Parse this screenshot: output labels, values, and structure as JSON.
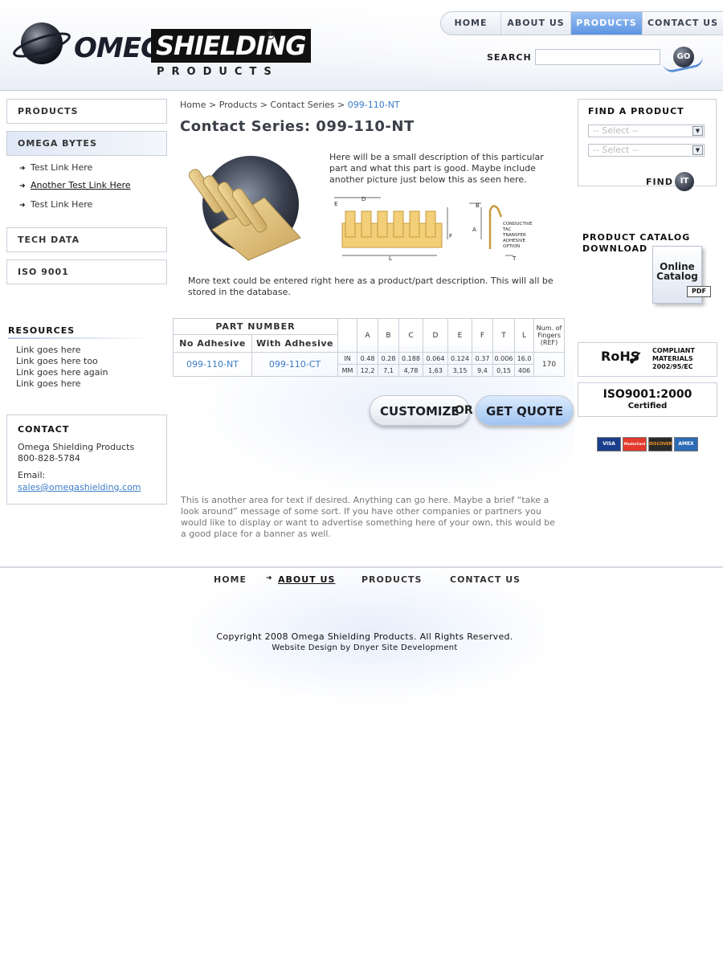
{
  "logo": {
    "word1": "OMEGA",
    "word2": "SHIELDING",
    "registered": "R",
    "sub": "PRODUCTS"
  },
  "topnav": [
    {
      "label": "HOME",
      "active": false
    },
    {
      "label": "ABOUT US",
      "active": false
    },
    {
      "label": "PRODUCTS",
      "active": true
    },
    {
      "label": "CONTACT US",
      "active": false
    }
  ],
  "search": {
    "label": "SEARCH",
    "value": "",
    "go_label": "GO"
  },
  "sidebar": {
    "products": "PRODUCTS",
    "omega_bytes": "OMEGA BYTES",
    "sublinks": [
      "Test Link Here",
      "Another Test Link Here",
      "Test Link Here"
    ],
    "tech_data": "TECH DATA",
    "iso": "ISO 9001",
    "resources_title": "RESOURCES",
    "resources": [
      "Link goes here",
      "Link goes here too",
      "Link goes here again",
      "Link goes here"
    ],
    "contact": {
      "title": "CONTACT",
      "company": "Omega Shielding Products",
      "phone": "800-828-5784",
      "email_label": "Email:",
      "email": "sales@omegashielding.com"
    }
  },
  "breadcrumb": {
    "home": "Home",
    "sep": ">",
    "products": "Products",
    "series": "Contact Series",
    "current": "099-110-NT"
  },
  "main": {
    "title": "Contact Series: 099-110-NT",
    "desc1": "Here will be a small description of this particular part and what this part is good. Maybe include another picture just below this as seen here.",
    "desc2": "More text could be entered right here as a product/part description. This will all be stored in the database.",
    "diagram_labels": [
      "E",
      "D",
      "B",
      "A",
      "F",
      "L",
      "T",
      "CONDUCTIVE",
      "TAC",
      "TRANSFER",
      "ADHESIVE",
      "OPTION"
    ],
    "promo": "This is another area for text if desired. Anything can go here. Maybe a brief “take a look around” message of some sort. If you have other companies or partners you would like to display or want to advertise something here of your own, this would be a good place for a banner as well.",
    "customize": "CUSTOMIZE",
    "or": "OR",
    "get_quote": "GET QUOTE"
  },
  "table": {
    "part_number": "PART NUMBER",
    "no_adhesive": "No Adhesive",
    "with_adhesive": "With Adhesive",
    "dim_headers": [
      "A",
      "B",
      "C",
      "D",
      "E",
      "F",
      "T",
      "L"
    ],
    "fingers_header": "Num. of Fingers (REF)",
    "pn_no": "099-110-NT",
    "pn_with": "099-110-CT",
    "in_label": "IN",
    "mm_label": "MM",
    "in_values": [
      "0.48",
      "0.28",
      "0.188",
      "0.064",
      "0.124",
      "0.37",
      "0.006",
      "16.0"
    ],
    "mm_values": [
      "12,2",
      "7,1",
      "4,78",
      "1,63",
      "3,15",
      "9,4",
      "0,15",
      "406"
    ],
    "fingers": "170"
  },
  "finder": {
    "title": "FIND A PRODUCT",
    "select1": "-- Select --",
    "select2": "-- Select --",
    "find_label": "FIND",
    "it_label": "IT"
  },
  "catalog": {
    "title_line1": "PRODUCT CATALOG",
    "title_line2": "DOWNLOAD",
    "doc_line1": "Online",
    "doc_line2": "Catalog",
    "badge": "PDF"
  },
  "rohs": {
    "big": "RoHS",
    "check": "✓",
    "line1": "COMPLIANT",
    "line2": "MATERIALS",
    "line3": "2002/95/EC"
  },
  "iso_badge": {
    "big": "ISO9001:2000",
    "small": "Certified"
  },
  "cards": [
    "VISA",
    "MasterCard",
    "DISCOVER",
    "AMEX"
  ],
  "colors": {
    "accent": "#3a7cc6",
    "nav_active": "#5d94e2"
  },
  "footer": {
    "nav": [
      "HOME",
      "ABOUT US",
      "PRODUCTS",
      "CONTACT US"
    ],
    "copyright": "Copyright  2008 Omega Shielding Products. All Rights Reserved.",
    "credit": "Website Design by Dnyer Site Development"
  }
}
